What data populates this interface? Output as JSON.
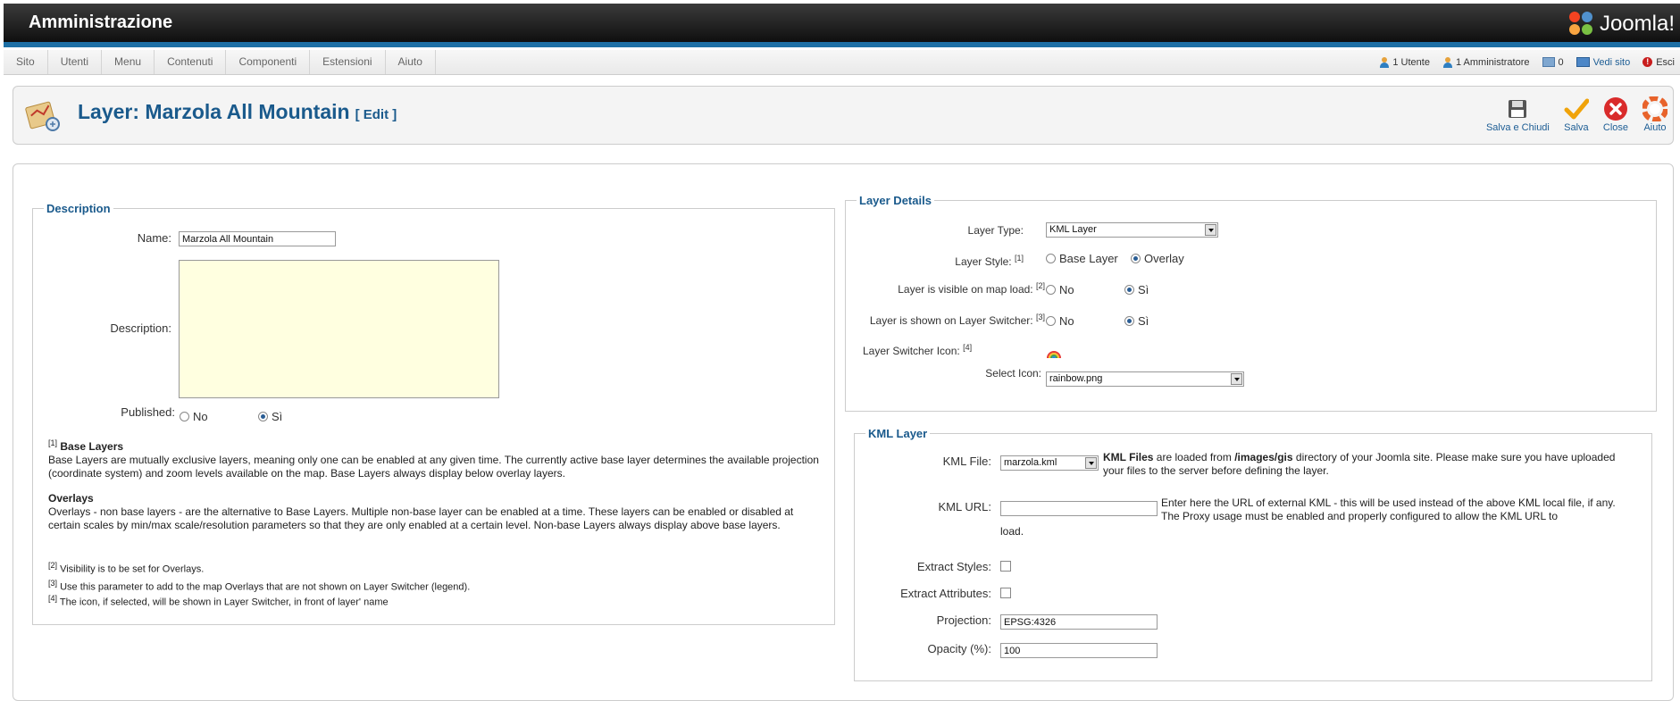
{
  "header": {
    "title": "Amministrazione",
    "logo_text": "Joomla!"
  },
  "menu": {
    "items": [
      "Sito",
      "Utenti",
      "Menu",
      "Contenuti",
      "Componenti",
      "Estensioni",
      "Aiuto"
    ]
  },
  "status": {
    "users": "1 Utente",
    "admins": "1 Amministratore",
    "messages": "0",
    "view_site": "Vedi sito",
    "logout": "Esci"
  },
  "toolbar": {
    "title": "Layer: Marzola All Mountain",
    "edit_label": "[ Edit ]",
    "buttons": [
      {
        "label": "Salva e Chiudi",
        "icon": "save-icon"
      },
      {
        "label": "Salva",
        "icon": "check-icon"
      },
      {
        "label": "Close",
        "icon": "close-icon"
      },
      {
        "label": "Aiuto",
        "icon": "help-icon"
      }
    ]
  },
  "description": {
    "legend": "Description",
    "name_label": "Name:",
    "name_value": "Marzola All Mountain",
    "desc_label": "Description:",
    "published_label": "Published:",
    "no_label": "No",
    "yes_label": "Sì",
    "published": "yes",
    "note1_ref": "[1]",
    "note1_title": "Base Layers",
    "note1_text": "Base Layers are mutually exclusive layers, meaning only one can be enabled at any given time. The currently active base layer determines the available projection (coordinate system) and zoom levels available on the map. Base Layers always display below overlay layers.",
    "overlays_title": "Overlays",
    "overlays_text": "Overlays - non base layers - are the alternative to Base Layers. Multiple non-base layer can be enabled at a time. These layers can be enabled or disabled at certain scales by min/max scale/resolution parameters so that they are only enabled at a certain level. Non-base Layers always display above base layers.",
    "note2_ref": "[2]",
    "note2": "Visibility is to be set for Overlays.",
    "note3_ref": "[3]",
    "note3": "Use this parameter to add to the map Overlays that are not shown on Layer Switcher (legend).",
    "note4_ref": "[4]",
    "note4": "The icon, if selected, will be shown in Layer Switcher, in front of layer' name"
  },
  "layer_details": {
    "legend": "Layer Details",
    "type_label": "Layer Type:",
    "type_value": "KML Layer",
    "style_label": "Layer Style:",
    "style_ref": "[1]",
    "style_base": "Base Layer",
    "style_overlay": "Overlay",
    "style_selected": "overlay",
    "visible_label": "Layer is visible on map load:",
    "visible_ref": "[2]",
    "switcher_label": "Layer is shown on Layer Switcher:",
    "switcher_ref": "[3]",
    "no_label": "No",
    "yes_label": "Sì",
    "visible": "yes",
    "switcher": "yes",
    "icon_label": "Layer Switcher Icon:",
    "icon_ref": "[4]",
    "select_icon_label": "Select Icon:",
    "select_icon_value": "rainbow.png"
  },
  "kml": {
    "legend": "KML Layer",
    "file_label": "KML File:",
    "file_value": "marzola.kml",
    "file_help_b1": "KML Files",
    "file_help_t1": " are loaded from ",
    "file_help_b2": "/images/gis",
    "file_help_t2": " directory of your Joomla site. Please make sure you have uploaded your files to the server before defining the layer.",
    "url_label": "KML URL:",
    "url_value": "",
    "url_help": "Enter here the URL of external KML - this will be used instead of the above KML local file, if any. The Proxy usage must be enabled and properly configured to allow the KML URL to",
    "url_help_tail": "load.",
    "styles_label": "Extract Styles:",
    "attrs_label": "Extract Attributes:",
    "projection_label": "Projection:",
    "projection_value": "EPSG:4326",
    "opacity_label": "Opacity (%):",
    "opacity_value": "100"
  }
}
